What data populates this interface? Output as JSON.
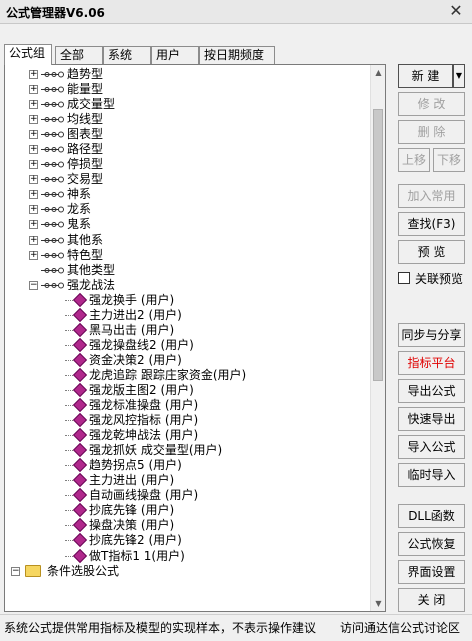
{
  "window": {
    "title": "公式管理器V6.06",
    "close_glyph": "✕"
  },
  "tabs": [
    "公式组",
    "全部",
    "系统",
    "用户",
    "按日期频度"
  ],
  "tree": [
    {
      "kind": "group",
      "label": "趋势型"
    },
    {
      "kind": "group",
      "label": "能量型"
    },
    {
      "kind": "group",
      "label": "成交量型"
    },
    {
      "kind": "group",
      "label": "均线型"
    },
    {
      "kind": "group",
      "label": "图表型"
    },
    {
      "kind": "group",
      "label": "路径型"
    },
    {
      "kind": "group",
      "label": "停损型"
    },
    {
      "kind": "group",
      "label": "交易型"
    },
    {
      "kind": "group",
      "label": "神系"
    },
    {
      "kind": "group",
      "label": "龙系"
    },
    {
      "kind": "group",
      "label": "鬼系"
    },
    {
      "kind": "group",
      "label": "其他系"
    },
    {
      "kind": "group",
      "label": "特色型"
    },
    {
      "kind": "group-empty",
      "label": "其他类型"
    },
    {
      "kind": "group-open",
      "label": "强龙战法"
    },
    {
      "kind": "leaf",
      "label": "强龙换手  (用户)"
    },
    {
      "kind": "leaf",
      "label": "主力进出2  (用户)"
    },
    {
      "kind": "leaf",
      "label": "黑马出击  (用户)"
    },
    {
      "kind": "leaf",
      "label": "强龙操盘线2  (用户)"
    },
    {
      "kind": "leaf",
      "label": "资金决策2  (用户)"
    },
    {
      "kind": "leaf",
      "label": "龙虎追踪  跟踪庄家资金(用户)"
    },
    {
      "kind": "leaf",
      "label": "强龙版主图2  (用户)"
    },
    {
      "kind": "leaf",
      "label": "强龙标准操盘  (用户)"
    },
    {
      "kind": "leaf",
      "label": "强龙风控指标  (用户)"
    },
    {
      "kind": "leaf",
      "label": "强龙乾坤战法  (用户)"
    },
    {
      "kind": "leaf",
      "label": "强龙抓妖  成交量型(用户)"
    },
    {
      "kind": "leaf",
      "label": "趋势拐点5  (用户)"
    },
    {
      "kind": "leaf",
      "label": "主力进出  (用户)"
    },
    {
      "kind": "leaf",
      "label": "自动画线操盘  (用户)"
    },
    {
      "kind": "leaf",
      "label": "抄底先锋  (用户)"
    },
    {
      "kind": "leaf",
      "label": "操盘决策  (用户)"
    },
    {
      "kind": "leaf",
      "label": "抄底先锋2  (用户)"
    },
    {
      "kind": "leaf",
      "label": "做T指标1  1(用户)"
    },
    {
      "kind": "folder",
      "label": "条件选股公式"
    }
  ],
  "buttons": {
    "new": "新 建",
    "new_dropdown": "▼",
    "modify": "修 改",
    "delete": "删 除",
    "move_up": "上移",
    "move_down": "下移",
    "add_common": "加入常用",
    "find": "查找(F3)",
    "preview": "预 览",
    "linked_preview": "关联预览",
    "sync_share": "同步与分享",
    "indicator_platform": "指标平台",
    "export": "导出公式",
    "quick_export": "快速导出",
    "import": "导入公式",
    "temp_import": "临时导入",
    "dll": "DLL函数",
    "restore": "公式恢复",
    "ui_settings": "界面设置",
    "close": "关 闭"
  },
  "status": {
    "left": "系统公式提供常用指标及模型的实现样本，不表示操作建议",
    "right": "访问通达信公式讨论区"
  },
  "colors": {
    "leaf_icon": "#b0288c",
    "highlight_red": "#e00000"
  }
}
